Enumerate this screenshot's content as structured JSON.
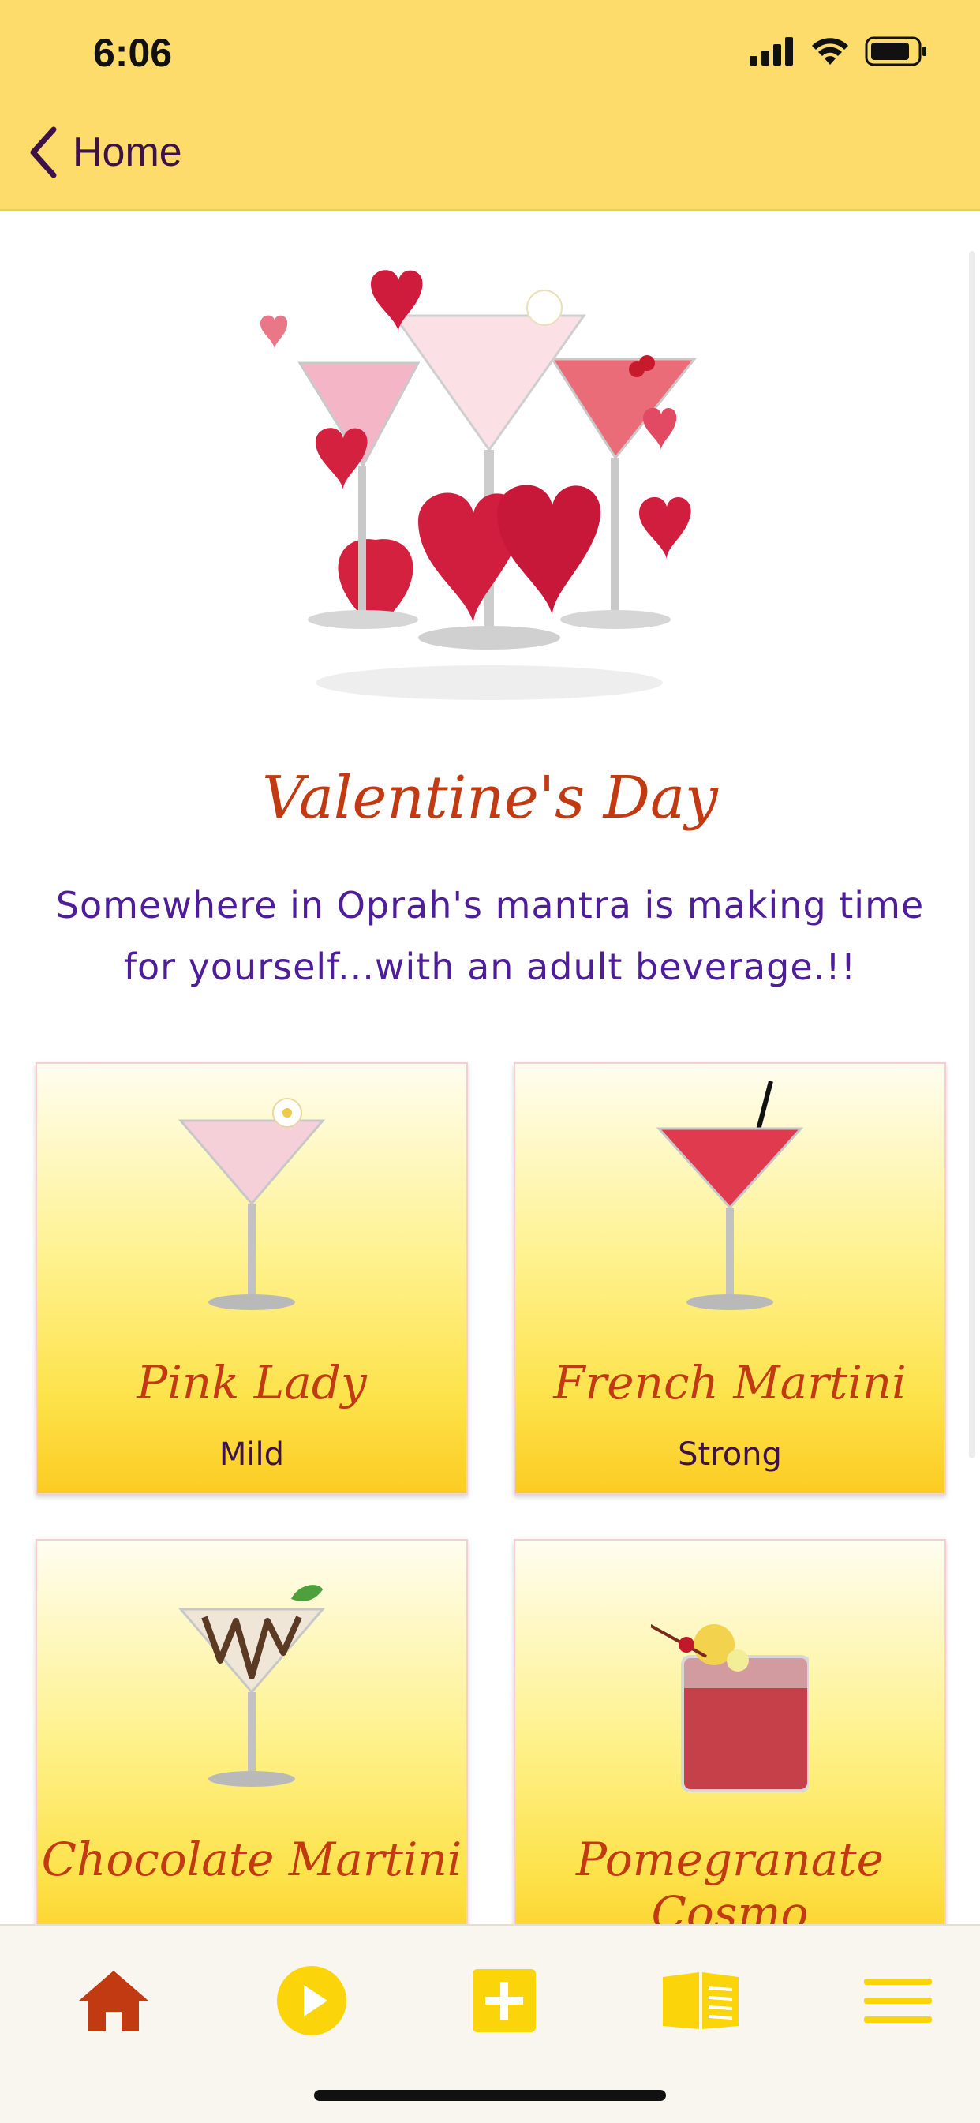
{
  "status_bar": {
    "time": "6:06"
  },
  "nav": {
    "back_label": "Home"
  },
  "hero": {
    "title": "Valentine's Day",
    "subtitle": "Somewhere in Oprah's mantra is making time for yourself...with an adult beverage.!!"
  },
  "cards": [
    {
      "name": "Pink Lady",
      "strength": "Mild"
    },
    {
      "name": "French Martini",
      "strength": "Strong"
    },
    {
      "name": "Chocolate Martini",
      "strength": ""
    },
    {
      "name": "Pomegranate Cosmo",
      "strength": ""
    }
  ],
  "tabbar": {
    "items": [
      {
        "icon": "home-icon",
        "active": true
      },
      {
        "icon": "play-icon",
        "active": false
      },
      {
        "icon": "add-icon",
        "active": false
      },
      {
        "icon": "book-icon",
        "active": false
      },
      {
        "icon": "menu-icon",
        "active": false
      }
    ]
  },
  "colors": {
    "header": "#fddc6c",
    "title": "#c23a12",
    "subtitle": "#4e1d99",
    "accent_yellow": "#fcd40a",
    "active_tab": "#c23a12"
  }
}
